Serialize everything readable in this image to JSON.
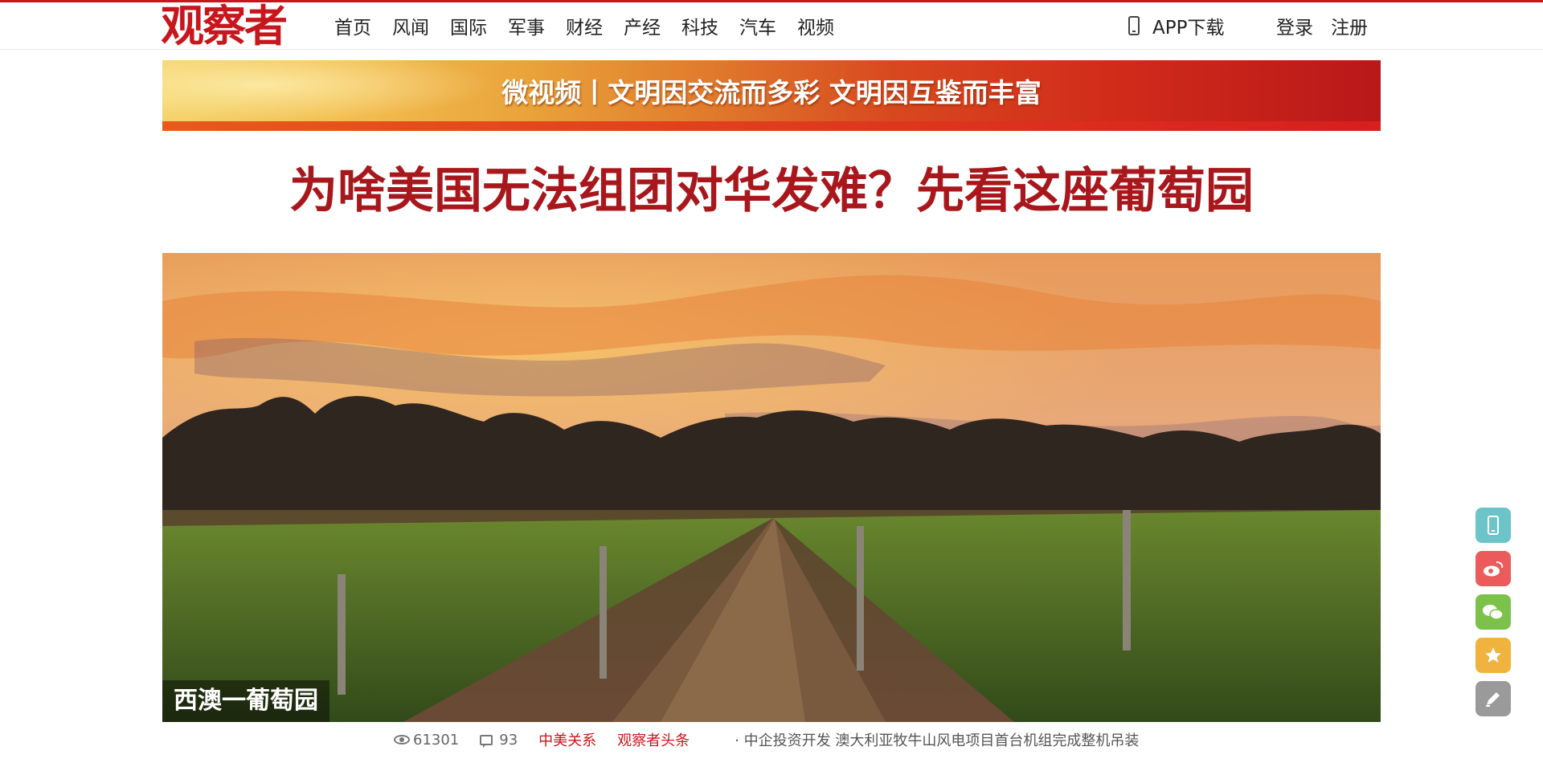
{
  "header": {
    "logo": "观察者",
    "nav": [
      "首页",
      "风闻",
      "国际",
      "军事",
      "财经",
      "产经",
      "科技",
      "汽车",
      "视频"
    ],
    "app_download": "APP下载",
    "login": "登录",
    "register": "注册"
  },
  "banner": {
    "text": "微视频丨文明因交流而多彩 文明因互鉴而丰富"
  },
  "article": {
    "title": "为啥美国无法组团对华发难？先看这座葡萄园",
    "image_caption": "西澳一葡萄园",
    "views": "61301",
    "comments": "93",
    "tags": [
      "中美关系",
      "观察者头条"
    ],
    "related_link": "· 中企投资开发 澳大利亚牧牛山风电项目首台机组完成整机吊装"
  },
  "share": {
    "items": [
      {
        "icon": "mobile-icon",
        "color": "#6cc3c8"
      },
      {
        "icon": "weibo-icon",
        "color": "#ec5b5b"
      },
      {
        "icon": "wechat-icon",
        "color": "#7cc24a"
      },
      {
        "icon": "star-icon",
        "color": "#f0b33e"
      },
      {
        "icon": "pen-icon",
        "color": "#9a9a9a"
      }
    ]
  },
  "colors": {
    "brand": "#c8161d",
    "headline": "#a8171c"
  }
}
